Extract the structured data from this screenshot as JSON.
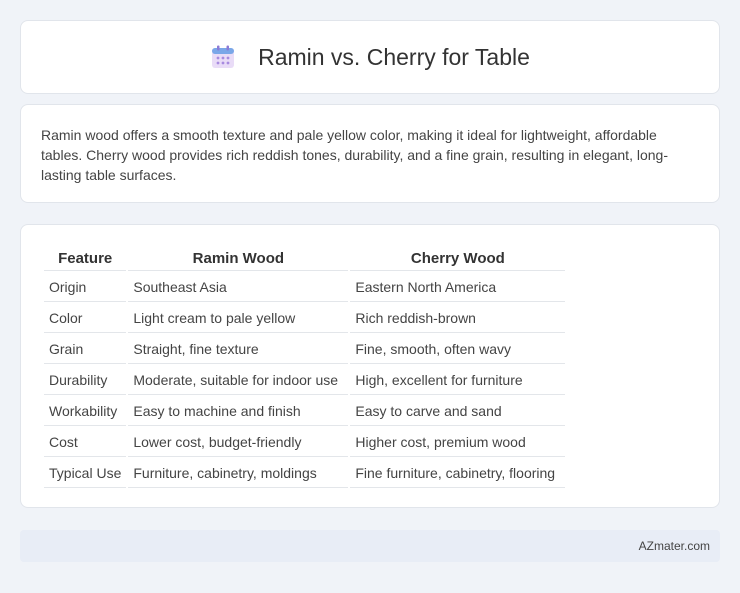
{
  "header": {
    "title": "Ramin vs. Cherry for Table",
    "icon": "calendar-icon"
  },
  "description": "Ramin wood offers a smooth texture and pale yellow color, making it ideal for lightweight, affordable tables. Cherry wood provides rich reddish tones, durability, and a fine grain, resulting in elegant, long-lasting table surfaces.",
  "table": {
    "headers": [
      "Feature",
      "Ramin Wood",
      "Cherry Wood"
    ],
    "rows": [
      [
        "Origin",
        "Southeast Asia",
        "Eastern North America"
      ],
      [
        "Color",
        "Light cream to pale yellow",
        "Rich reddish-brown"
      ],
      [
        "Grain",
        "Straight, fine texture",
        "Fine, smooth, often wavy"
      ],
      [
        "Durability",
        "Moderate, suitable for indoor use",
        "High, excellent for furniture"
      ],
      [
        "Workability",
        "Easy to machine and finish",
        "Easy to carve and sand"
      ],
      [
        "Cost",
        "Lower cost, budget-friendly",
        "Higher cost, premium wood"
      ],
      [
        "Typical Use",
        "Furniture, cabinetry, moldings",
        "Fine furniture, cabinetry, flooring"
      ]
    ]
  },
  "footer": {
    "site": "AZmater.com"
  }
}
